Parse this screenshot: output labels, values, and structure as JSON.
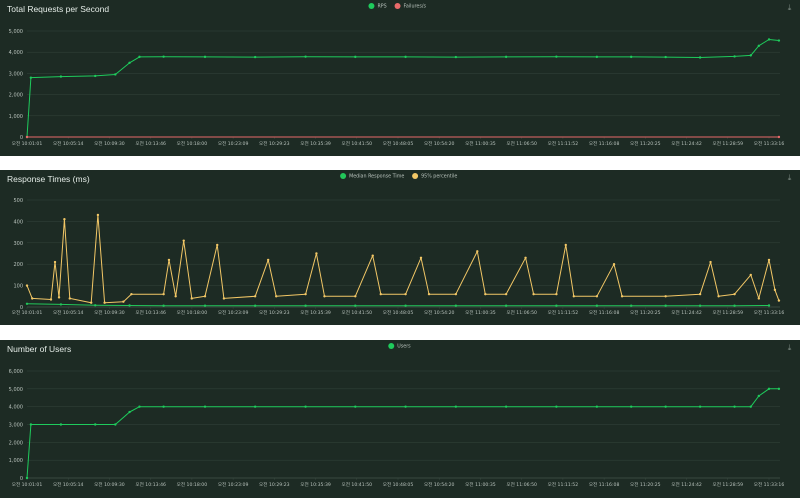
{
  "icons": {
    "download": "download-icon"
  },
  "colors": {
    "panel_bg": "#1d2b24",
    "grid": "#34453c",
    "text": "#b8c2bc",
    "rps": "#1ecb5c",
    "failures": "#e86a6a",
    "median": "#22c75a",
    "p95": "#f2c766",
    "users": "#1ecb5c"
  },
  "x_labels": [
    "오전 10:01:01",
    "오전 10:05:14",
    "오전 10:09:30",
    "오전 10:13:46",
    "오전 10:18:00",
    "오전 10:23:09",
    "오전 10:29:23",
    "오전 10:35:39",
    "오전 10:41:50",
    "오전 10:48:05",
    "오전 10:54:20",
    "오전 11:00:35",
    "오전 11:06:50",
    "오전 11:11:52",
    "오전 11:16:08",
    "오전 11:20:25",
    "오전 11:24:42",
    "오전 11:28:59",
    "오전 11:33:16"
  ],
  "chart_data": [
    {
      "type": "line",
      "title": "Total Requests per Second",
      "xlabel": "",
      "ylabel": "",
      "ylim": [
        0,
        5000
      ],
      "y_ticks": [
        "0",
        "1,000",
        "2,000",
        "3,000",
        "4,000",
        "5,000"
      ],
      "grid": true,
      "legend": "top-center",
      "x_range": [
        "오전 10:01:01",
        "오전 11:33:16"
      ],
      "series": [
        {
          "name": "RPS",
          "color": "#1ecb5c",
          "points": [
            [
              "오전 10:01:01",
              0
            ],
            [
              "오전 10:01:30",
              2800
            ],
            [
              "오전 10:05:14",
              2850
            ],
            [
              "오전 10:09:30",
              2880
            ],
            [
              "오전 10:12:00",
              2950
            ],
            [
              "오전 10:13:46",
              3500
            ],
            [
              "오전 10:15:00",
              3780
            ],
            [
              "오전 10:18:00",
              3790
            ],
            [
              "오전 10:23:09",
              3780
            ],
            [
              "오전 10:29:23",
              3770
            ],
            [
              "오전 10:35:39",
              3790
            ],
            [
              "오전 10:41:50",
              3780
            ],
            [
              "오전 10:48:05",
              3780
            ],
            [
              "오전 10:54:20",
              3770
            ],
            [
              "오전 11:00:35",
              3780
            ],
            [
              "오전 11:06:50",
              3790
            ],
            [
              "오전 11:11:52",
              3780
            ],
            [
              "오전 11:16:08",
              3780
            ],
            [
              "오전 11:20:25",
              3770
            ],
            [
              "오전 11:24:42",
              3750
            ],
            [
              "오전 11:28:59",
              3800
            ],
            [
              "오전 11:31:00",
              3850
            ],
            [
              "오전 11:32:00",
              4300
            ],
            [
              "오전 11:33:16",
              4600
            ],
            [
              "오전 11:34:30",
              4550
            ]
          ]
        },
        {
          "name": "Failures/s",
          "color": "#e86a6a",
          "points": [
            [
              "오전 10:01:01",
              0
            ],
            [
              "오전 11:34:30",
              0
            ]
          ]
        }
      ]
    },
    {
      "type": "line",
      "title": "Response Times (ms)",
      "xlabel": "",
      "ylabel": "",
      "ylim": [
        0,
        500
      ],
      "y_ticks": [
        "0",
        "100",
        "200",
        "300",
        "400",
        "500"
      ],
      "grid": true,
      "legend": "top-center",
      "x_range": [
        "오전 10:01:01",
        "오전 11:33:16"
      ],
      "series": [
        {
          "name": "Median Response Time",
          "color": "#22c75a",
          "points": [
            [
              "오전 10:01:01",
              15
            ],
            [
              "오전 10:05:14",
              12
            ],
            [
              "오전 10:09:30",
              8
            ],
            [
              "오전 10:13:46",
              7
            ],
            [
              "오전 10:18:00",
              6
            ],
            [
              "오전 10:23:09",
              6
            ],
            [
              "오전 10:29:23",
              6
            ],
            [
              "오전 10:35:39",
              6
            ],
            [
              "오전 10:41:50",
              6
            ],
            [
              "오전 10:48:05",
              6
            ],
            [
              "오전 10:54:20",
              6
            ],
            [
              "오전 11:00:35",
              6
            ],
            [
              "오전 11:06:50",
              6
            ],
            [
              "오전 11:11:52",
              6
            ],
            [
              "오전 11:16:08",
              6
            ],
            [
              "오전 11:20:25",
              6
            ],
            [
              "오전 11:24:42",
              6
            ],
            [
              "오전 11:28:59",
              6
            ],
            [
              "오전 11:33:16",
              7
            ]
          ]
        },
        {
          "name": "95% percentile",
          "color": "#f2c766",
          "points": [
            [
              "오전 10:01:01",
              100
            ],
            [
              "오전 10:01:40",
              40
            ],
            [
              "오전 10:04:00",
              35
            ],
            [
              "오전 10:04:30",
              210
            ],
            [
              "오전 10:05:00",
              45
            ],
            [
              "오전 10:05:40",
              410
            ],
            [
              "오전 10:06:20",
              40
            ],
            [
              "오전 10:09:00",
              20
            ],
            [
              "오전 10:09:50",
              430
            ],
            [
              "오전 10:10:40",
              20
            ],
            [
              "오전 10:13:00",
              25
            ],
            [
              "오전 10:14:00",
              60
            ],
            [
              "오전 10:18:00",
              60
            ],
            [
              "오전 10:18:40",
              220
            ],
            [
              "오전 10:19:30",
              50
            ],
            [
              "오전 10:20:30",
              310
            ],
            [
              "오전 10:21:30",
              40
            ],
            [
              "오전 10:23:09",
              50
            ],
            [
              "오전 10:24:40",
              290
            ],
            [
              "오전 10:25:30",
              40
            ],
            [
              "오전 10:29:23",
              50
            ],
            [
              "오전 10:31:00",
              220
            ],
            [
              "오전 10:32:00",
              50
            ],
            [
              "오전 10:35:39",
              60
            ],
            [
              "오전 10:37:00",
              250
            ],
            [
              "오전 10:38:00",
              50
            ],
            [
              "오전 10:41:50",
              50
            ],
            [
              "오전 10:44:00",
              240
            ],
            [
              "오전 10:45:00",
              60
            ],
            [
              "오전 10:48:05",
              60
            ],
            [
              "오전 10:50:00",
              230
            ],
            [
              "오전 10:51:00",
              60
            ],
            [
              "오전 10:54:20",
              60
            ],
            [
              "오전 10:57:00",
              260
            ],
            [
              "오전 10:58:00",
              60
            ],
            [
              "오전 11:00:35",
              60
            ],
            [
              "오전 11:03:00",
              230
            ],
            [
              "오전 11:04:00",
              60
            ],
            [
              "오전 11:06:50",
              60
            ],
            [
              "오전 11:08:00",
              290
            ],
            [
              "오전 11:09:00",
              50
            ],
            [
              "오전 11:11:52",
              50
            ],
            [
              "오전 11:14:00",
              200
            ],
            [
              "오전 11:15:00",
              50
            ],
            [
              "오전 11:20:25",
              50
            ],
            [
              "오전 11:24:42",
              60
            ],
            [
              "오전 11:26:00",
              210
            ],
            [
              "오전 11:27:00",
              50
            ],
            [
              "오전 11:28:59",
              60
            ],
            [
              "오전 11:31:00",
              150
            ],
            [
              "오전 11:32:00",
              40
            ],
            [
              "오전 11:33:16",
              220
            ],
            [
              "오전 11:34:00",
              80
            ],
            [
              "오전 11:34:30",
              30
            ]
          ]
        }
      ]
    },
    {
      "type": "line",
      "title": "Number of Users",
      "xlabel": "",
      "ylabel": "",
      "ylim": [
        0,
        6000
      ],
      "y_ticks": [
        "0",
        "1,000",
        "2,000",
        "3,000",
        "4,000",
        "5,000",
        "6,000"
      ],
      "grid": true,
      "legend": "top-center",
      "x_range": [
        "오전 10:01:01",
        "오전 11:33:16"
      ],
      "series": [
        {
          "name": "Users",
          "color": "#1ecb5c",
          "points": [
            [
              "오전 10:01:01",
              0
            ],
            [
              "오전 10:01:30",
              3000
            ],
            [
              "오전 10:05:14",
              3000
            ],
            [
              "오전 10:09:30",
              3000
            ],
            [
              "오전 10:12:00",
              3000
            ],
            [
              "오전 10:13:46",
              3700
            ],
            [
              "오전 10:15:00",
              4000
            ],
            [
              "오전 10:18:00",
              4000
            ],
            [
              "오전 10:23:09",
              4000
            ],
            [
              "오전 10:29:23",
              4000
            ],
            [
              "오전 10:35:39",
              4000
            ],
            [
              "오전 10:41:50",
              4000
            ],
            [
              "오전 10:48:05",
              4000
            ],
            [
              "오전 10:54:20",
              4000
            ],
            [
              "오전 11:00:35",
              4000
            ],
            [
              "오전 11:06:50",
              4000
            ],
            [
              "오전 11:11:52",
              4000
            ],
            [
              "오전 11:16:08",
              4000
            ],
            [
              "오전 11:20:25",
              4000
            ],
            [
              "오전 11:24:42",
              4000
            ],
            [
              "오전 11:28:59",
              4000
            ],
            [
              "오전 11:31:00",
              4000
            ],
            [
              "오전 11:32:00",
              4600
            ],
            [
              "오전 11:33:16",
              5000
            ],
            [
              "오전 11:34:30",
              5000
            ]
          ]
        }
      ]
    }
  ]
}
